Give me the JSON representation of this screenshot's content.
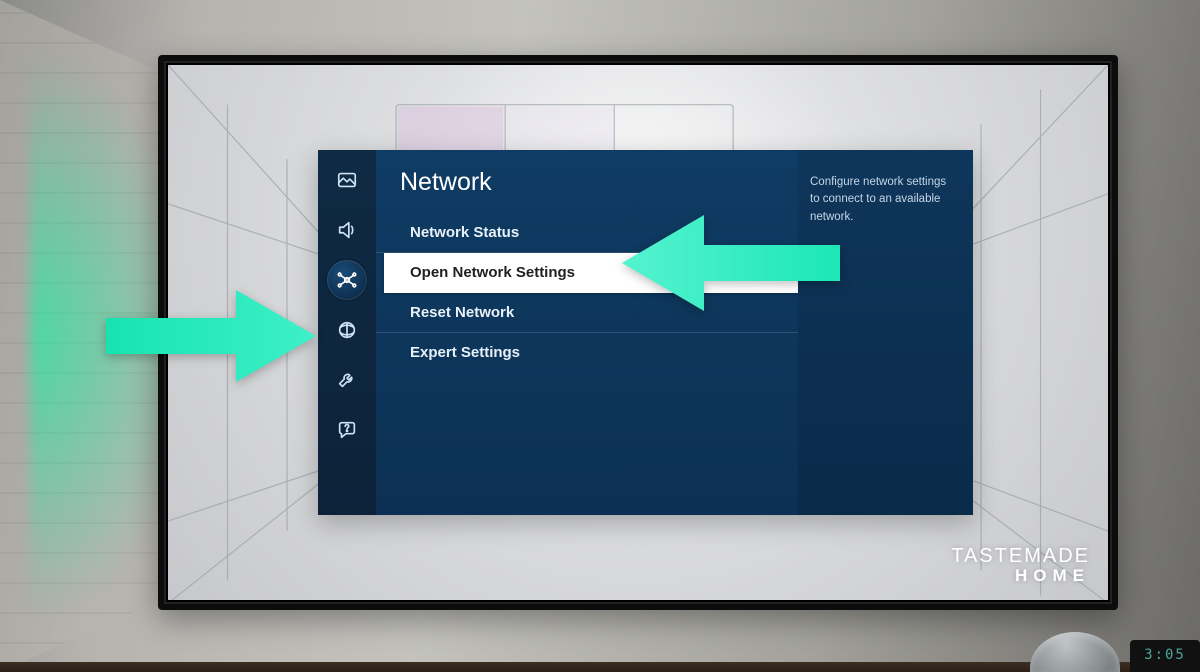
{
  "panel_title": "Network",
  "menu": [
    {
      "label": "Network Status",
      "selected": false
    },
    {
      "label": "Open Network Settings",
      "selected": true
    },
    {
      "label": "Reset Network",
      "selected": false
    },
    {
      "label": "Expert Settings",
      "selected": false
    }
  ],
  "help_text": "Configure network settings to connect to an available network.",
  "sidebar_icons": [
    {
      "name": "picture-icon",
      "active": false
    },
    {
      "name": "sound-icon",
      "active": false
    },
    {
      "name": "connection-icon",
      "active": true
    },
    {
      "name": "satellite-icon",
      "active": false
    },
    {
      "name": "wrench-icon",
      "active": false
    },
    {
      "name": "support-icon",
      "active": false
    }
  ],
  "watermark": {
    "line1": "TASTEMADE",
    "line2": "HOME"
  },
  "clock_time": "3:05"
}
